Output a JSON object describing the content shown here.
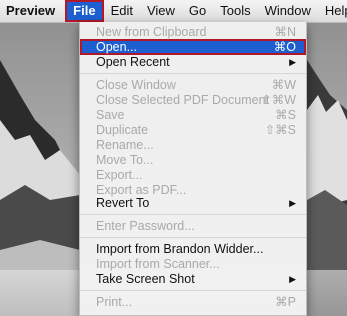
{
  "menubar": {
    "apple_icon": "",
    "app_name": "Preview",
    "items": [
      "File",
      "Edit",
      "View",
      "Go",
      "Tools",
      "Window",
      "Help"
    ]
  },
  "file_menu": {
    "new_from_clipboard": {
      "label": "New from Clipboard",
      "shortcut": "⌘N"
    },
    "open": {
      "label": "Open...",
      "shortcut": "⌘O"
    },
    "open_recent": {
      "label": "Open Recent"
    },
    "close_window": {
      "label": "Close Window",
      "shortcut": "⌘W"
    },
    "close_selected_pdf": {
      "label": "Close Selected PDF Document",
      "shortcut": "⇧⌘W"
    },
    "save": {
      "label": "Save",
      "shortcut": "⌘S"
    },
    "duplicate": {
      "label": "Duplicate",
      "shortcut": "⇧⌘S"
    },
    "rename": {
      "label": "Rename..."
    },
    "move_to": {
      "label": "Move To..."
    },
    "export": {
      "label": "Export..."
    },
    "export_as_pdf": {
      "label": "Export as PDF..."
    },
    "revert_to": {
      "label": "Revert To"
    },
    "enter_password": {
      "label": "Enter Password..."
    },
    "import_from_device": {
      "label": "Import from Brandon Widder..."
    },
    "import_from_scanner": {
      "label": "Import from Scanner..."
    },
    "take_screen_shot": {
      "label": "Take Screen Shot"
    },
    "print": {
      "label": "Print...",
      "shortcut": "⌘P"
    },
    "submenu_arrow": "▶"
  },
  "colors": {
    "highlight": "#1d5fd0",
    "highlight_outline": "#b01828",
    "disabled_text": "#a9a9a9"
  }
}
